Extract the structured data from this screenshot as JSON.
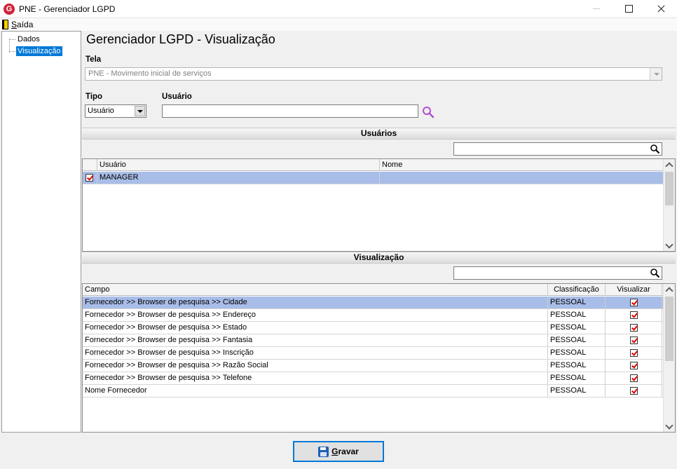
{
  "window": {
    "title": "PNE - Gerenciador LGPD",
    "app_icon": "G"
  },
  "menu": {
    "exit_label": "Saída"
  },
  "tree": {
    "items": [
      {
        "label": "Dados"
      },
      {
        "label": "Visualização"
      }
    ]
  },
  "page": {
    "title": "Gerenciador LGPD - Visualização"
  },
  "form": {
    "tela_label": "Tela",
    "tela_value": "PNE - Movimento inicial de serviços",
    "tipo_label": "Tipo",
    "tipo_value": "Usuário",
    "usuario_label": "Usuário",
    "usuario_value": ""
  },
  "users_section": {
    "title": "Usuários",
    "filter_value": "",
    "columns": [
      "Usuário",
      "Nome"
    ],
    "rows": [
      {
        "usuario": "MANAGER",
        "nome": "",
        "checked": true
      }
    ]
  },
  "view_section": {
    "title": "Visualização",
    "filter_value": "",
    "columns": [
      "Campo",
      "Classificação",
      "Visualizar"
    ],
    "rows": [
      {
        "campo": "Fornecedor >> Browser de pesquisa >> Cidade",
        "classificacao": "PESSOAL",
        "visualizar": true
      },
      {
        "campo": "Fornecedor >> Browser de pesquisa >> Endereço",
        "classificacao": "PESSOAL",
        "visualizar": true
      },
      {
        "campo": "Fornecedor >> Browser de pesquisa >> Estado",
        "classificacao": "PESSOAL",
        "visualizar": true
      },
      {
        "campo": "Fornecedor >> Browser de pesquisa >> Fantasia",
        "classificacao": "PESSOAL",
        "visualizar": true
      },
      {
        "campo": "Fornecedor >> Browser de pesquisa >> Inscrição",
        "classificacao": "PESSOAL",
        "visualizar": true
      },
      {
        "campo": "Fornecedor >> Browser de pesquisa >> Razão Social",
        "classificacao": "PESSOAL",
        "visualizar": true
      },
      {
        "campo": "Fornecedor >> Browser de pesquisa >> Telefone",
        "classificacao": "PESSOAL",
        "visualizar": true
      },
      {
        "campo": "Nome Fornecedor",
        "classificacao": "PESSOAL",
        "visualizar": true
      }
    ]
  },
  "buttons": {
    "save_label": "Gravar"
  },
  "colors": {
    "selection": "#a8bde8",
    "tree_selection": "#0078d7",
    "check": "#e00000",
    "search_icon": "#b04fd0"
  }
}
